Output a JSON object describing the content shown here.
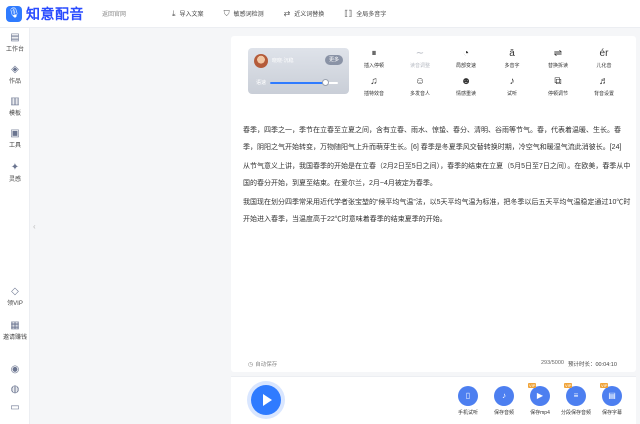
{
  "app": {
    "logo_icon": "mic-icon",
    "title": "知意配音",
    "back_link": "返回官网"
  },
  "topbar": {
    "tools": [
      {
        "icon": "import-icon",
        "label": "导入文案"
      },
      {
        "icon": "shield-icon",
        "label": "敏感词检测"
      },
      {
        "icon": "replace-icon",
        "label": "近义词替换"
      },
      {
        "icon": "polyphone-icon",
        "label": "全局多音字"
      }
    ]
  },
  "sidebar": {
    "items": [
      {
        "icon": "desk-icon",
        "label": "工作台"
      },
      {
        "icon": "stack-icon",
        "label": "作品"
      },
      {
        "icon": "template-icon",
        "label": "模板"
      },
      {
        "icon": "toolbox-icon",
        "label": "工具"
      },
      {
        "icon": "ai-icon",
        "label": "灵感"
      },
      {
        "icon": "diamond-icon",
        "label": "领VIP"
      },
      {
        "icon": "gift-icon",
        "label": "邀请赚钱"
      },
      {
        "icon": "support-icon",
        "label": ""
      },
      {
        "icon": "user-icon",
        "label": ""
      },
      {
        "icon": "message-icon",
        "label": ""
      }
    ]
  },
  "voice": {
    "name": "晓晓·沉稳",
    "change_label": "更多",
    "speed_label": "语速",
    "speed_fraction": 0.82
  },
  "tools": [
    {
      "icon": "pause-icon",
      "label": "插入停顿",
      "disabled": false
    },
    {
      "icon": "pronounce-icon",
      "label": "读音调整",
      "disabled": true
    },
    {
      "icon": "speed-icon",
      "label": "局部变速",
      "disabled": false
    },
    {
      "icon": "polyphone-icon",
      "label": "多音字",
      "disabled": false
    },
    {
      "icon": "swap-icon",
      "label": "替换拆读",
      "disabled": false
    },
    {
      "icon": "er-icon",
      "label": "儿化音",
      "disabled": false
    },
    {
      "icon": "music-icon",
      "label": "插特效音",
      "disabled": false
    },
    {
      "icon": "multi-voice-icon",
      "label": "多发音人",
      "disabled": false
    },
    {
      "icon": "emotion-icon",
      "label": "情感重读",
      "disabled": false
    },
    {
      "icon": "headphone-icon",
      "label": "试听",
      "disabled": false
    },
    {
      "icon": "voice-adjust-icon",
      "label": "停顿调节",
      "disabled": false
    },
    {
      "icon": "bgm-icon",
      "label": "背音设置",
      "disabled": false
    }
  ],
  "editor": {
    "paragraphs": [
      "春季，四季之一，季节在立春至立夏之间，含有立春、雨水、惊蛰、春分、清明、谷雨等节气。春，代表着温暖、生长。春季，阴阳之气开始转变，万物随阳气上升而萌芽生长。[6] 春季是冬夏季风交替转换时期，冷空气和暖湿气流此消彼长。[24]",
      "从节气意义上讲，我国春季的开始是在立春（2月2日至5日之间），春季的结束在立夏（5月5日至7日之间）。在欧美，春季从中国的春分开始，到夏至结束。在爱尔兰，2月~4月被定为春季。",
      "我国现在划分四季常采用近代学者张宝堃的“候平均气温”法，以5天平均气温为标准，把冬季以后五天平均气温稳定通过10℃时开始进入春季，当温度高于22℃时意味着春季的结束夏季的开始。"
    ]
  },
  "status": {
    "autosave": "自动保存",
    "char_count": "293/5000",
    "duration": "预计时长：00:04:10"
  },
  "bottom_actions": [
    {
      "icon": "phone-icon",
      "label": "手机试听",
      "vip": false
    },
    {
      "icon": "audio-icon",
      "label": "保存音频",
      "vip": false
    },
    {
      "icon": "mp4-icon",
      "label": "保存mp4",
      "vip": true
    },
    {
      "icon": "split-icon",
      "label": "分段保存音频",
      "vip": true
    },
    {
      "icon": "subtitle-icon",
      "label": "保存字幕",
      "vip": true
    }
  ],
  "colors": {
    "accent": "#2f7bff",
    "logo_text": "#2a4cff",
    "vip": "#f0a43a"
  }
}
